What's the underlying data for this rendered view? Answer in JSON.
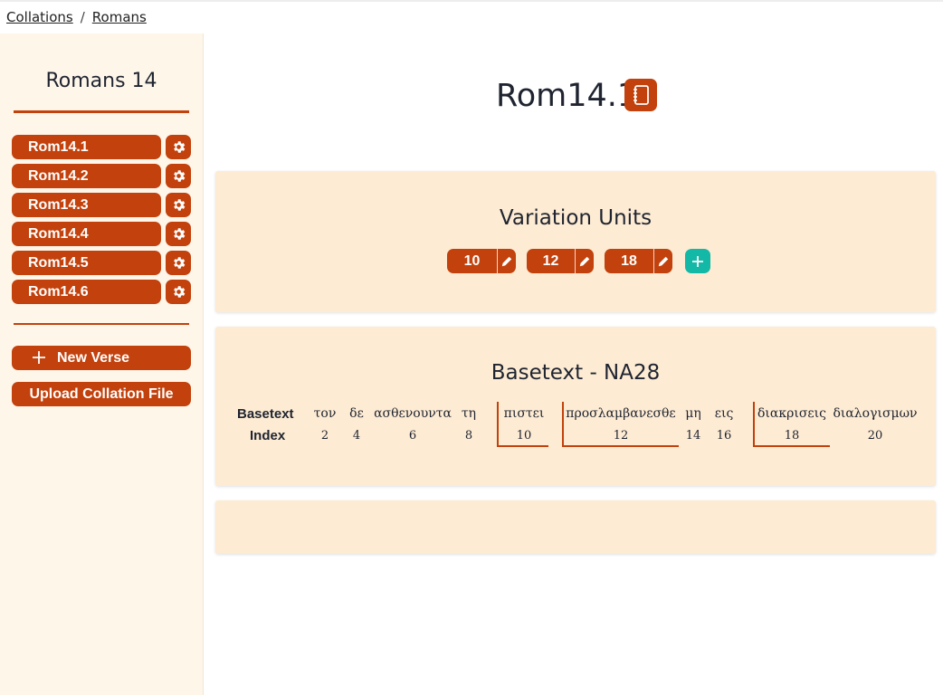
{
  "breadcrumb": {
    "items": [
      "Collations",
      "Romans"
    ],
    "separator": "/"
  },
  "sidebar": {
    "title": "Romans 14",
    "verses": [
      {
        "label": "Rom14.1"
      },
      {
        "label": "Rom14.2"
      },
      {
        "label": "Rom14.3"
      },
      {
        "label": "Rom14.4"
      },
      {
        "label": "Rom14.5"
      },
      {
        "label": "Rom14.6"
      }
    ],
    "new_verse_label": "New Verse",
    "upload_label": "Upload Collation File"
  },
  "main": {
    "title": "Rom14.1",
    "variation_units": {
      "title": "Variation Units",
      "units": [
        {
          "label": "10"
        },
        {
          "label": "12"
        },
        {
          "label": "18"
        }
      ]
    },
    "basetext": {
      "title": "Basetext - NA28",
      "row_label_1": "Basetext",
      "row_label_2": "Index",
      "words": [
        {
          "text": "τον",
          "index": "2"
        },
        {
          "text": "δε",
          "index": "4"
        },
        {
          "text": "ασθενουντα",
          "index": "6"
        },
        {
          "text": "τη",
          "index": "8"
        },
        {
          "text": "πιστει",
          "index": "10"
        },
        {
          "text": "προσλαμβανεσθε",
          "index": "12"
        },
        {
          "text": "μη",
          "index": "14"
        },
        {
          "text": "εις",
          "index": "16"
        },
        {
          "text": "διακρισεις",
          "index": "18"
        },
        {
          "text": "διαλογισμων",
          "index": "20"
        }
      ]
    }
  },
  "colors": {
    "accent": "#c2410c",
    "add_button": "#14b8a6",
    "card_bg": "#fdebd3",
    "sidebar_bg": "#fff6ea"
  }
}
